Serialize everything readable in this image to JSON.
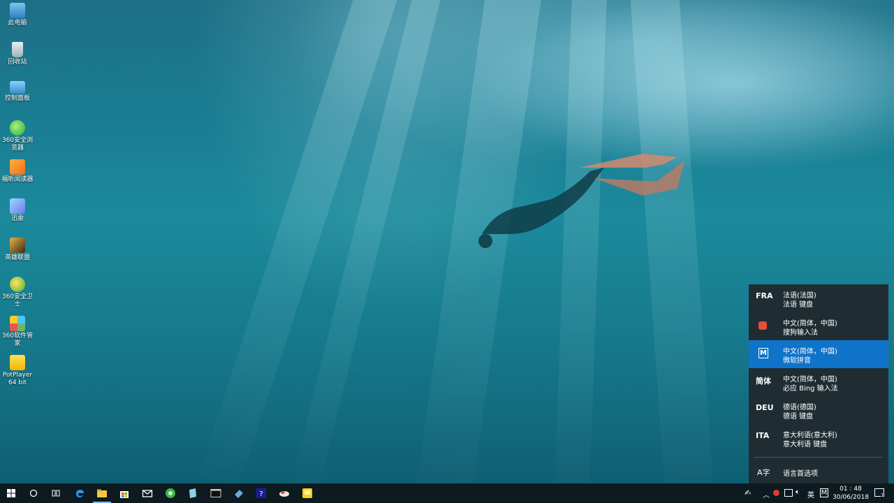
{
  "desktop": {
    "icons": [
      {
        "label": "此电脑",
        "icon": "this-pc-icon"
      },
      {
        "label": "回收站",
        "icon": "recycle-bin-icon"
      },
      {
        "label": "控制面板",
        "icon": "control-panel-icon"
      },
      {
        "label": "360安全浏览器",
        "icon": "360-browser-icon"
      },
      {
        "label": "福昕阅读器",
        "icon": "foxit-reader-icon"
      },
      {
        "label": "迅雷",
        "icon": "xunlei-icon"
      },
      {
        "label": "英雄联盟",
        "icon": "league-of-legends-icon"
      },
      {
        "label": "360安全卫士",
        "icon": "360-safe-guard-icon"
      },
      {
        "label": "360软件管家",
        "icon": "360-software-manager-icon"
      },
      {
        "label": "PotPlayer 64 bit",
        "icon": "potplayer-icon"
      }
    ]
  },
  "language_panel": {
    "items": [
      {
        "code": "FRA",
        "line1": "法语(法国)",
        "line2": "法语 键盘",
        "selected": false
      },
      {
        "code": "",
        "icon": "sogou-ime-icon",
        "line1": "中文(简体，中国)",
        "line2": "搜狗输入法",
        "selected": false
      },
      {
        "code": "M",
        "line1": "中文(简体，中国)",
        "line2": "微软拼音",
        "selected": true
      },
      {
        "code": "简体",
        "line1": "中文(简体，中国)",
        "line2": "必应 Bing 输入法",
        "selected": false
      },
      {
        "code": "DEU",
        "line1": "德语(德国)",
        "line2": "德语 键盘",
        "selected": false
      },
      {
        "code": "ITA",
        "line1": "意大利语(意大利)",
        "line2": "意大利语 键盘",
        "selected": false
      }
    ],
    "preferences_label": "语言首选项",
    "preferences_icon_text": "A字",
    "accent": "#0f73c9"
  },
  "taskbar": {
    "apps": [
      "start-icon",
      "search-icon",
      "task-view-icon",
      "edge-icon",
      "file-explorer-icon",
      "store-icon",
      "mail-icon",
      "360-browser-icon",
      "notepad-icon",
      "terminal-icon",
      "app-icon",
      "help-icon",
      "cloud-app-icon",
      "potplayer-icon"
    ],
    "tray": {
      "ime_mode": "英",
      "ime_indicator": "M",
      "time": "01 : 48",
      "date": "30/06/2018",
      "notification_count": "1"
    }
  }
}
